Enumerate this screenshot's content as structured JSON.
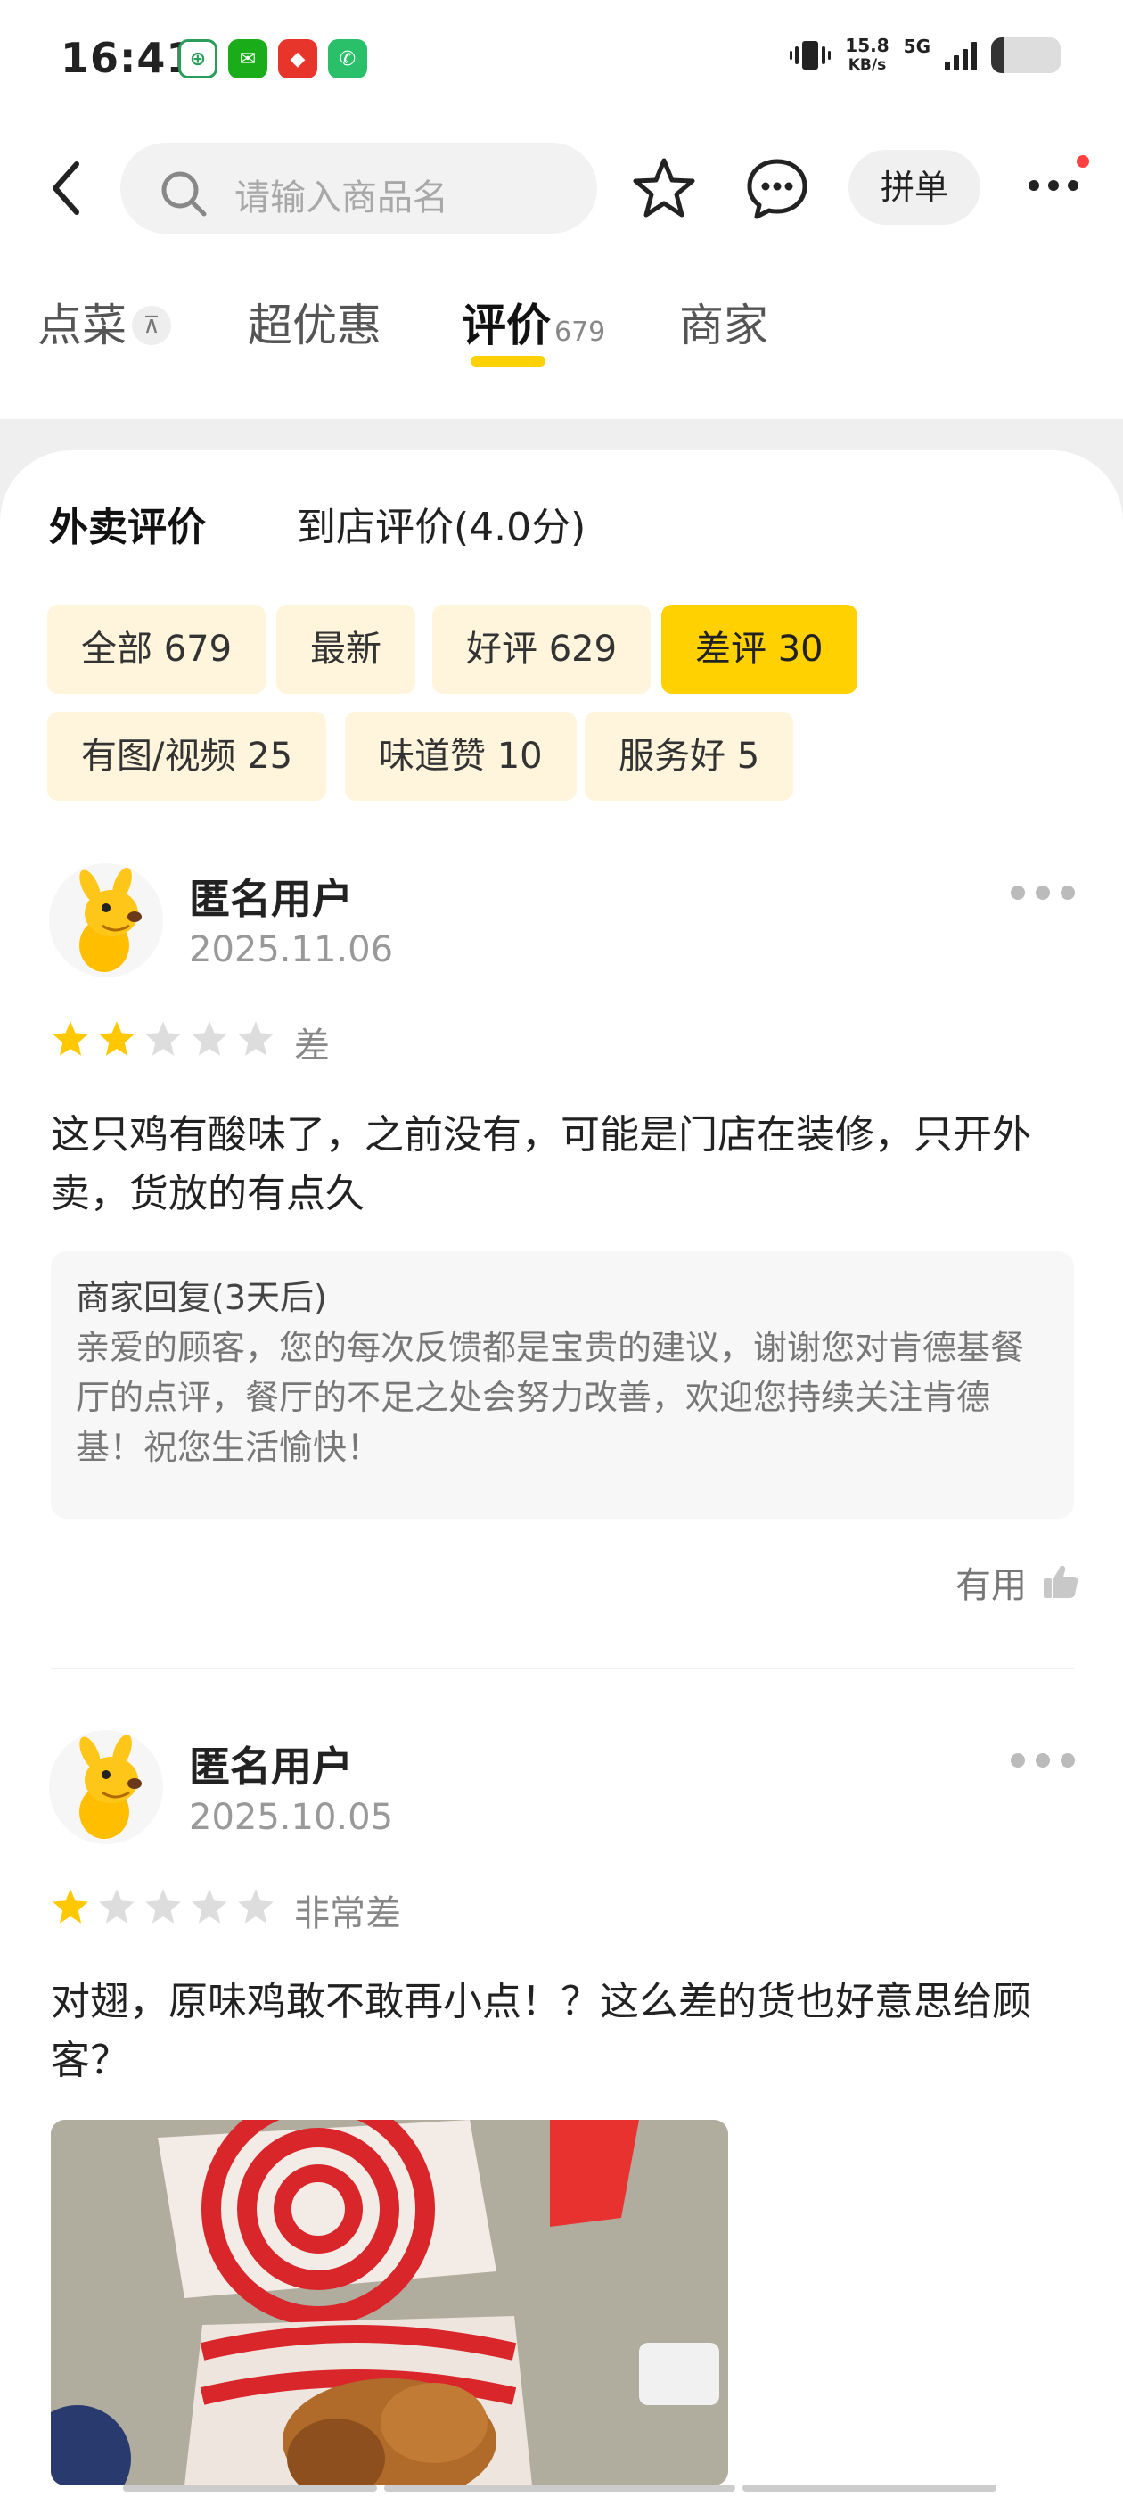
{
  "status_bar": {
    "time": "16:41",
    "speed_value": "15.8",
    "speed_unit": "KB/s",
    "network": "5G"
  },
  "header": {
    "search_placeholder": "请输入商品名",
    "pindan_label": "拼单"
  },
  "tabs": [
    {
      "label": "点菜",
      "badge": "⊼"
    },
    {
      "label": "超优惠"
    },
    {
      "label": "评价",
      "count": "679"
    },
    {
      "label": "商家"
    }
  ],
  "review_types": [
    "外卖评价",
    "到店评价(4.0分)"
  ],
  "filters": [
    "全部 679",
    "最新",
    "好评 629",
    "差评 30",
    "有图/视频 25",
    "味道赞 10",
    "服务好 5"
  ],
  "active_filter_index": 3,
  "reviews": [
    {
      "user": "匿名用户",
      "date": "2025.11.06",
      "rating": 2,
      "rating_label": "差",
      "text": "这只鸡有酸味了，之前没有，可能是门店在装修，只开外卖，货放的有点久",
      "reply_title": "商家回复(3天后)",
      "reply_text": "亲爱的顾客，您的每次反馈都是宝贵的建议，谢谢您对肯德基餐厅的点评，餐厅的不足之处会努力改善，欢迎您持续关注肯德基！祝您生活愉快！",
      "useful_label": "有用"
    },
    {
      "user": "匿名用户",
      "date": "2025.10.05",
      "rating": 1,
      "rating_label": "非常差",
      "text": "对翅，原味鸡敢不敢再小点！？这么差的货也好意思给顾客？"
    }
  ],
  "colors": {
    "accent": "#ffd100",
    "chip_bg": "#fff5dd",
    "star_on": "#ffc800",
    "star_off": "#dddddd"
  }
}
